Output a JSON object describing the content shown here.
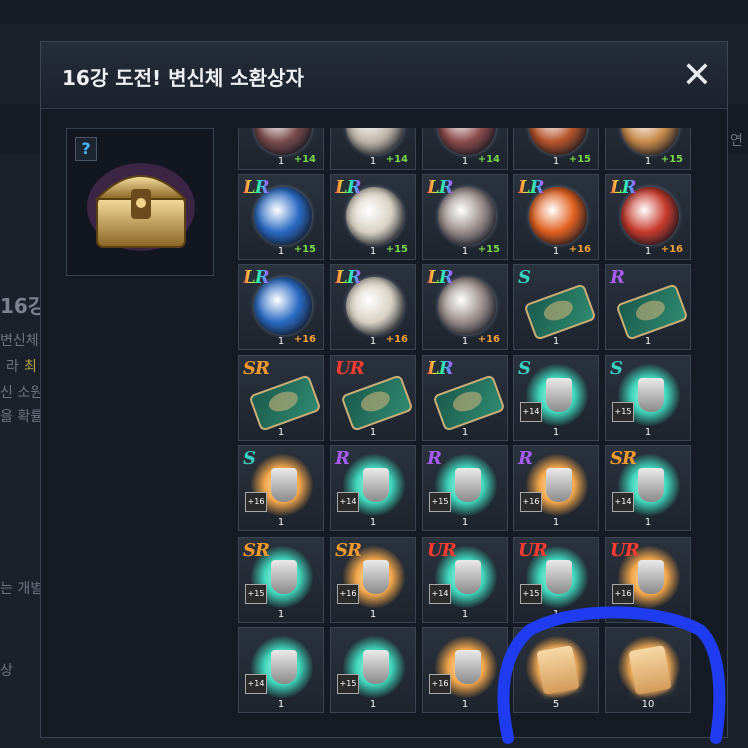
{
  "background": {
    "texts": [
      "16강",
      "변신체",
      "라",
      "최",
      "신 소원",
      "을 확률",
      "연",
      "는 개별",
      "상"
    ]
  },
  "modal": {
    "title": "16강 도전! 변신체 소환상자",
    "close_symbol": "✕",
    "preview_help_symbol": "?"
  },
  "grid": {
    "rows": [
      [
        {
          "grade": "",
          "type": "orb",
          "color": "#7a4b4b",
          "qty": "1",
          "plus": "+14"
        },
        {
          "grade": "",
          "type": "orb",
          "color": "#bdb4a6",
          "qty": "1",
          "plus": "+14"
        },
        {
          "grade": "",
          "type": "orb",
          "color": "#8b4a4a",
          "qty": "1",
          "plus": "+14"
        },
        {
          "grade": "",
          "type": "orb",
          "color": "#b5532a",
          "qty": "1",
          "plus": "+15"
        },
        {
          "grade": "",
          "type": "orb",
          "color": "#c88a4a",
          "qty": "1",
          "plus": "+15"
        }
      ],
      [
        {
          "grade": "LR",
          "type": "orb",
          "color": "#2a6bc4",
          "qty": "1",
          "plus": "+15"
        },
        {
          "grade": "LR",
          "type": "orb",
          "color": "#d9d2c3",
          "qty": "1",
          "plus": "+15"
        },
        {
          "grade": "LR",
          "type": "orb",
          "color": "#9a8d8b",
          "qty": "1",
          "plus": "+15"
        },
        {
          "grade": "LR",
          "type": "orb",
          "color": "#e1601f",
          "qty": "1",
          "plus": "+16"
        },
        {
          "grade": "LR",
          "type": "orb",
          "color": "#c83a2c",
          "qty": "1",
          "plus": "+16"
        }
      ],
      [
        {
          "grade": "LR",
          "type": "orb",
          "color": "#2a6bc4",
          "qty": "1",
          "plus": "+16"
        },
        {
          "grade": "LR",
          "type": "orb",
          "color": "#d9d2c3",
          "qty": "1",
          "plus": "+16"
        },
        {
          "grade": "LR",
          "type": "orb",
          "color": "#9a8d8b",
          "qty": "1",
          "plus": "+16"
        },
        {
          "grade": "S",
          "type": "card",
          "qty": "1"
        },
        {
          "grade": "R",
          "type": "card",
          "qty": "1"
        }
      ],
      [
        {
          "grade": "SR",
          "type": "card",
          "qty": "1"
        },
        {
          "grade": "UR",
          "type": "card",
          "qty": "1"
        },
        {
          "grade": "LR",
          "type": "card",
          "qty": "1"
        },
        {
          "grade": "S",
          "type": "teal",
          "qty": "1",
          "badge": "+14"
        },
        {
          "grade": "S",
          "type": "teal",
          "qty": "1",
          "badge": "+15"
        }
      ],
      [
        {
          "grade": "S",
          "type": "orange",
          "qty": "1",
          "badge": "+16"
        },
        {
          "grade": "R",
          "type": "teal",
          "qty": "1",
          "badge": "+14"
        },
        {
          "grade": "R",
          "type": "teal",
          "qty": "1",
          "badge": "+15"
        },
        {
          "grade": "R",
          "type": "orange",
          "qty": "1",
          "badge": "+16"
        },
        {
          "grade": "SR",
          "type": "teal",
          "qty": "1",
          "badge": "+14"
        }
      ],
      [
        {
          "grade": "SR",
          "type": "teal",
          "qty": "1",
          "badge": "+15"
        },
        {
          "grade": "SR",
          "type": "orange",
          "qty": "1",
          "badge": "+16"
        },
        {
          "grade": "UR",
          "type": "teal",
          "qty": "1",
          "badge": "+14"
        },
        {
          "grade": "UR",
          "type": "teal",
          "qty": "1",
          "badge": "+15"
        },
        {
          "grade": "UR",
          "type": "orange",
          "qty": "1",
          "badge": "+16"
        }
      ],
      [
        {
          "grade": "",
          "type": "teal",
          "qty": "1",
          "badge": "+14"
        },
        {
          "grade": "",
          "type": "teal",
          "qty": "1",
          "badge": "+15"
        },
        {
          "grade": "",
          "type": "orange",
          "qty": "1",
          "badge": "+16"
        },
        {
          "grade": "",
          "type": "scroll",
          "qty": "5"
        },
        {
          "grade": "",
          "type": "scroll",
          "qty": "10"
        }
      ]
    ]
  },
  "colors": {
    "grade_LR": "rainbow",
    "grade_S": "#3ad1c5",
    "grade_R": "#a65cf2",
    "grade_SR": "#f39a2d",
    "grade_UR": "#ff3b2f",
    "annotation": "#1f3cf0"
  }
}
